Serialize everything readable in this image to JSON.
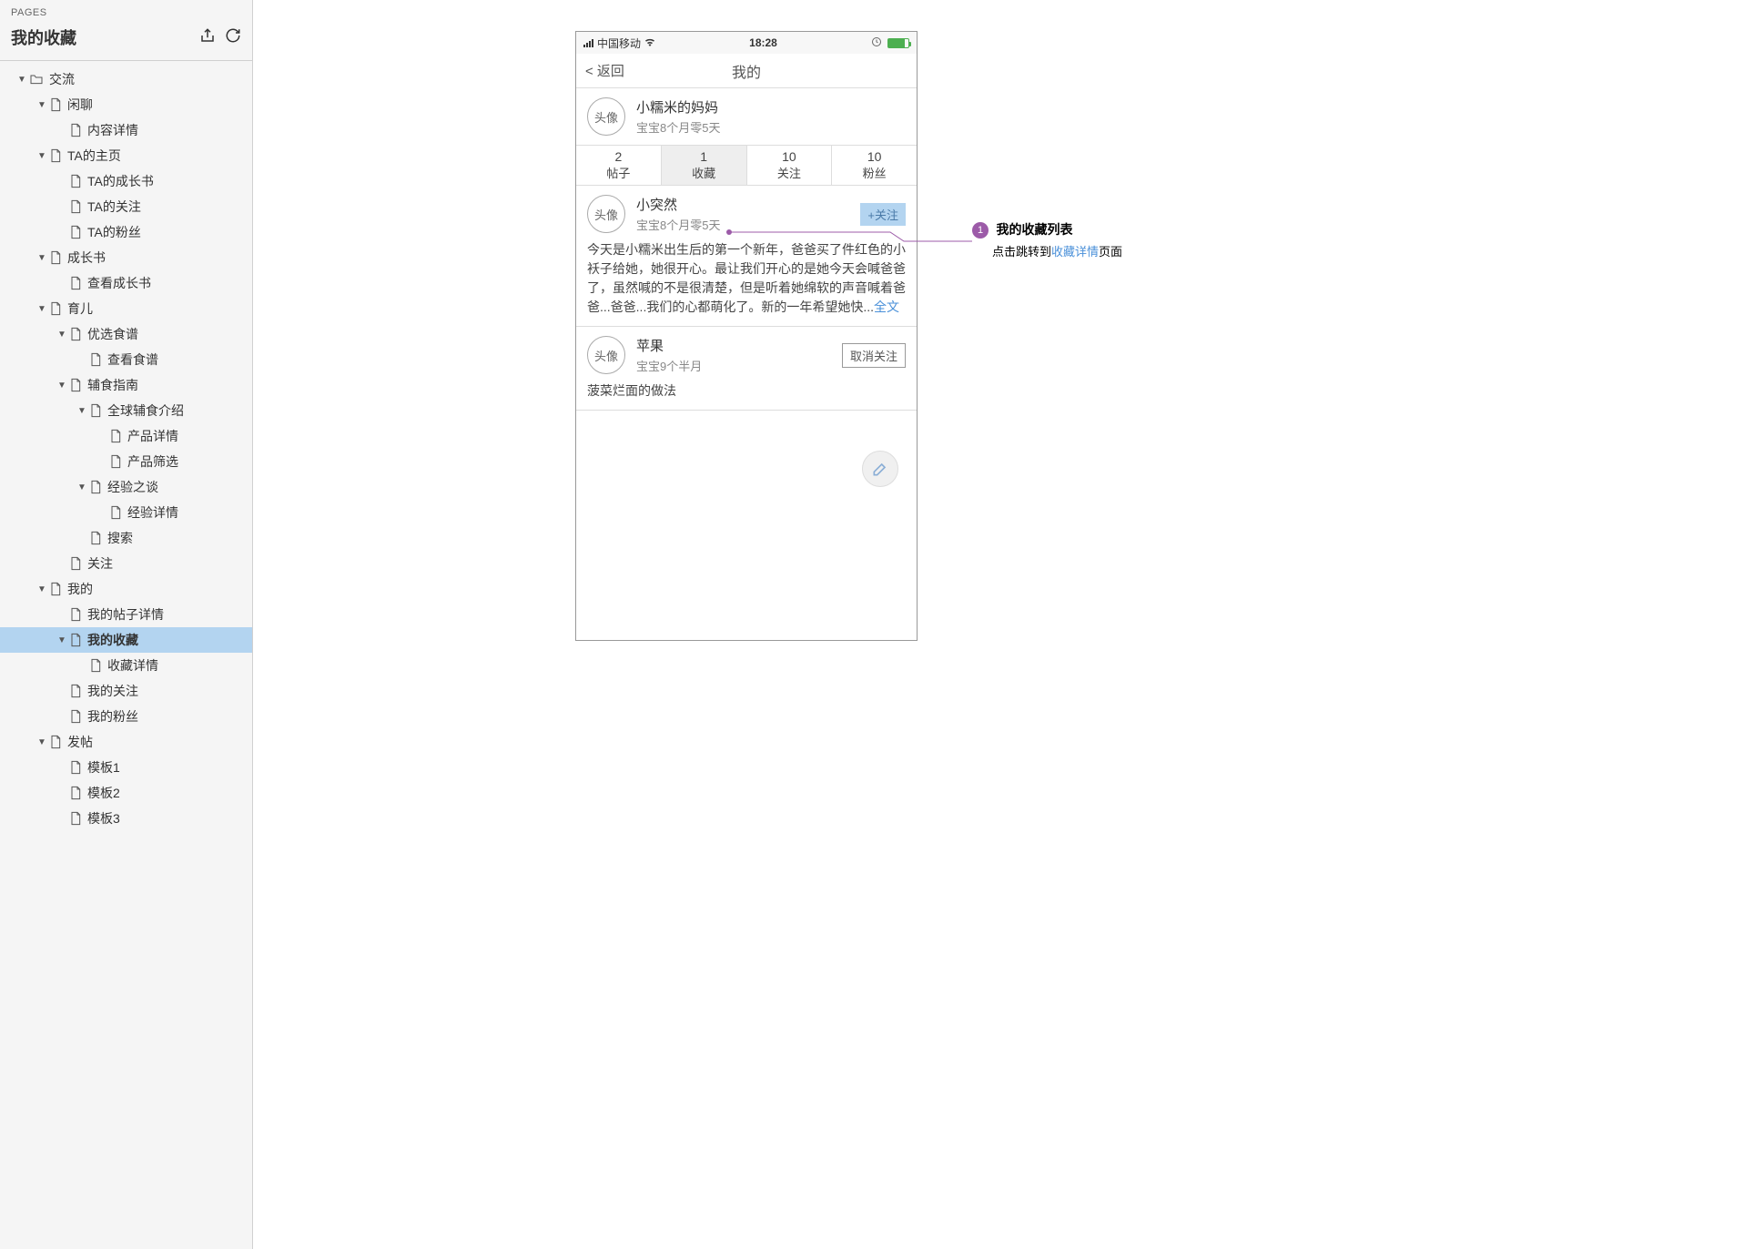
{
  "sidebar": {
    "pages_label": "PAGES",
    "title": "我的收藏",
    "tree": [
      {
        "level": 0,
        "arrow": true,
        "type": "folder",
        "label": "交流"
      },
      {
        "level": 1,
        "arrow": true,
        "type": "page",
        "label": "闲聊"
      },
      {
        "level": 2,
        "arrow": false,
        "type": "page",
        "label": "内容详情"
      },
      {
        "level": 1,
        "arrow": true,
        "type": "page",
        "label": "TA的主页"
      },
      {
        "level": 2,
        "arrow": false,
        "type": "page",
        "label": "TA的成长书"
      },
      {
        "level": 2,
        "arrow": false,
        "type": "page",
        "label": "TA的关注"
      },
      {
        "level": 2,
        "arrow": false,
        "type": "page",
        "label": "TA的粉丝"
      },
      {
        "level": 1,
        "arrow": true,
        "type": "page",
        "label": "成长书"
      },
      {
        "level": 2,
        "arrow": false,
        "type": "page",
        "label": "查看成长书"
      },
      {
        "level": 1,
        "arrow": true,
        "type": "page",
        "label": "育儿"
      },
      {
        "level": 2,
        "arrow": true,
        "type": "page",
        "label": "优选食谱"
      },
      {
        "level": 3,
        "arrow": false,
        "type": "page",
        "label": "查看食谱"
      },
      {
        "level": 2,
        "arrow": true,
        "type": "page",
        "label": "辅食指南"
      },
      {
        "level": 3,
        "arrow": true,
        "type": "page",
        "label": "全球辅食介绍"
      },
      {
        "level": 4,
        "arrow": false,
        "type": "page",
        "label": "产品详情"
      },
      {
        "level": 4,
        "arrow": false,
        "type": "page",
        "label": "产品筛选"
      },
      {
        "level": 3,
        "arrow": true,
        "type": "page",
        "label": "经验之谈"
      },
      {
        "level": 4,
        "arrow": false,
        "type": "page",
        "label": "经验详情"
      },
      {
        "level": 3,
        "arrow": false,
        "type": "page",
        "label": "搜索"
      },
      {
        "level": 2,
        "arrow": false,
        "type": "page",
        "label": "关注"
      },
      {
        "level": 1,
        "arrow": true,
        "type": "page",
        "label": "我的"
      },
      {
        "level": 2,
        "arrow": false,
        "type": "page",
        "label": "我的帖子详情"
      },
      {
        "level": 2,
        "arrow": true,
        "type": "page",
        "label": "我的收藏",
        "selected": true
      },
      {
        "level": 3,
        "arrow": false,
        "type": "page",
        "label": "收藏详情"
      },
      {
        "level": 2,
        "arrow": false,
        "type": "page",
        "label": "我的关注"
      },
      {
        "level": 2,
        "arrow": false,
        "type": "page",
        "label": "我的粉丝"
      },
      {
        "level": 1,
        "arrow": true,
        "type": "page",
        "label": "发帖"
      },
      {
        "level": 2,
        "arrow": false,
        "type": "page",
        "label": "模板1"
      },
      {
        "level": 2,
        "arrow": false,
        "type": "page",
        "label": "模板2"
      },
      {
        "level": 2,
        "arrow": false,
        "type": "page",
        "label": "模板3"
      }
    ]
  },
  "phone": {
    "status": {
      "carrier": "中国移动",
      "time": "18:28"
    },
    "nav": {
      "back": "< 返回",
      "title": "我的"
    },
    "profile": {
      "avatar_label": "头像",
      "name": "小糯米的妈妈",
      "sub": "宝宝8个月零5天"
    },
    "stats": [
      {
        "num": "2",
        "label": "帖子"
      },
      {
        "num": "1",
        "label": "收藏",
        "active": true
      },
      {
        "num": "10",
        "label": "关注"
      },
      {
        "num": "10",
        "label": "粉丝"
      }
    ],
    "items": [
      {
        "avatar": "头像",
        "name": "小突然",
        "sub": "宝宝8个月零5天",
        "action": "+关注",
        "action_type": "follow",
        "body": "今天是小糯米出生后的第一个新年，爸爸买了件红色的小袄子给她，她很开心。最让我们开心的是她今天会喊爸爸了，虽然喊的不是很清楚，但是听着她绵软的声音喊着爸爸...爸爸...我们的心都萌化了。新的一年希望她快...",
        "fulltext": "全文"
      },
      {
        "avatar": "头像",
        "name": "苹果",
        "sub": "宝宝9个半月",
        "action": "取消关注",
        "action_type": "unfollow",
        "body": "菠菜烂面的做法"
      }
    ]
  },
  "annotation": {
    "badge": "1",
    "title": "我的收藏列表",
    "body_pre": "点击跳转到",
    "body_link": "收藏详情",
    "body_post": "页面"
  }
}
